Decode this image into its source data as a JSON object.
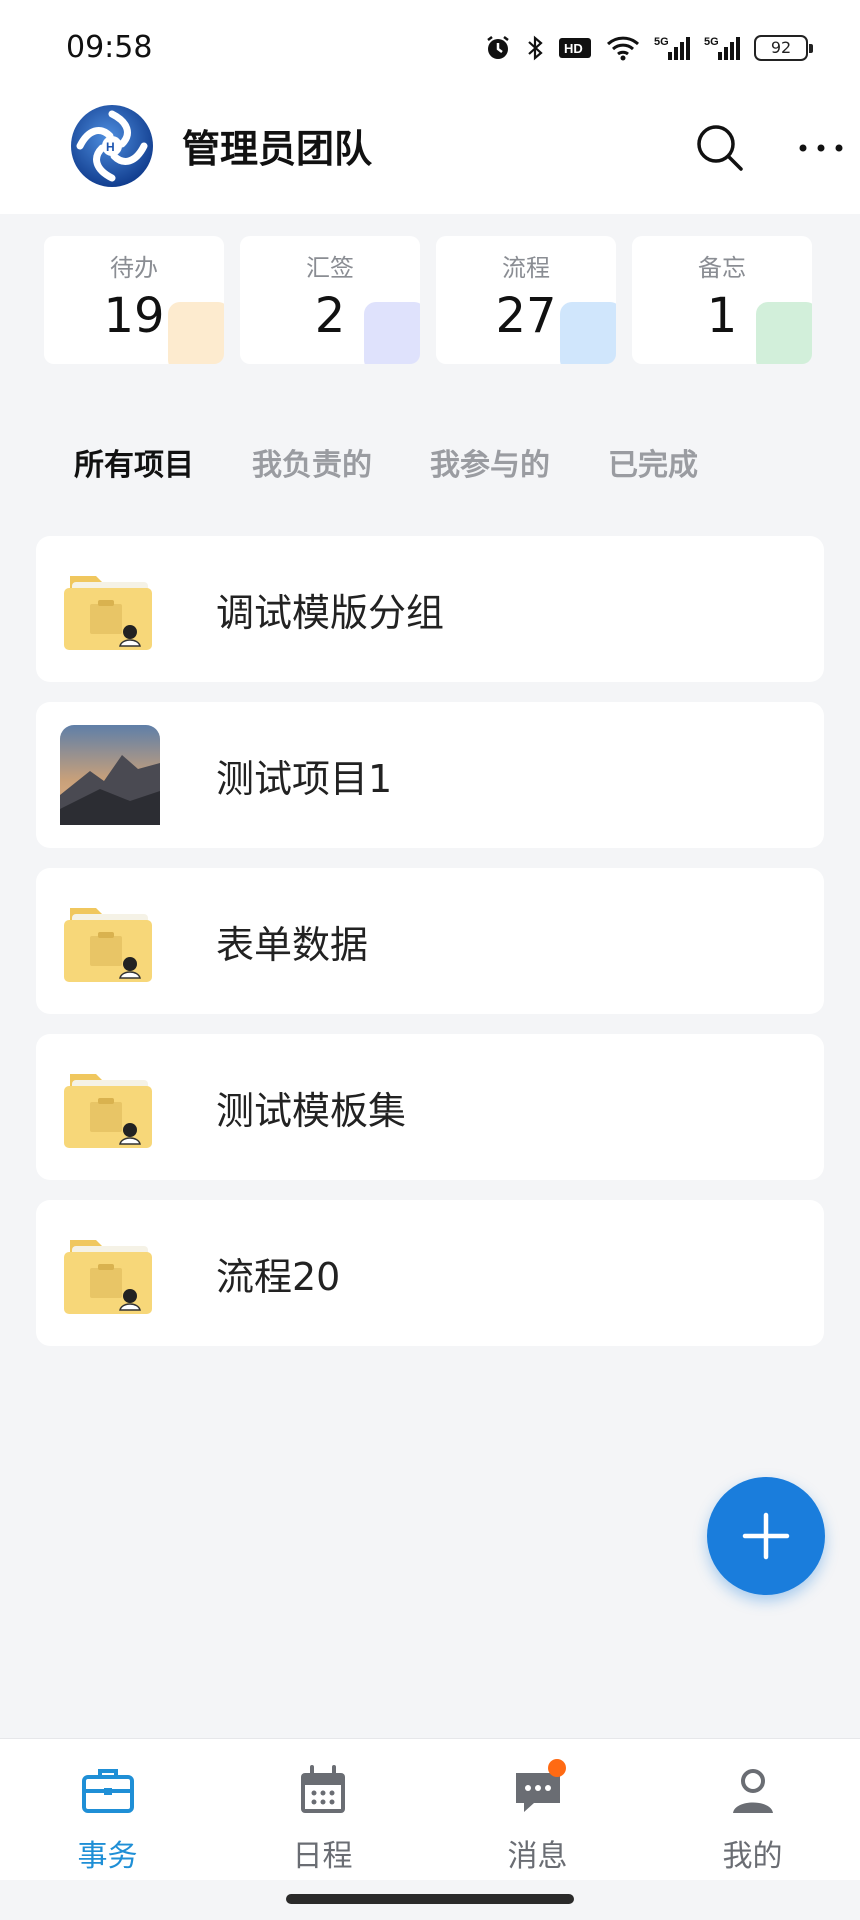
{
  "status_bar": {
    "time": "09:58",
    "battery": "92"
  },
  "header": {
    "title": "管理员团队"
  },
  "stats": [
    {
      "label": "待办",
      "value": "19",
      "accent": "#f5a623"
    },
    {
      "label": "汇签",
      "value": "2",
      "accent": "#6c7cf0"
    },
    {
      "label": "流程",
      "value": "27",
      "accent": "#2a8cf0"
    },
    {
      "label": "备忘",
      "value": "1",
      "accent": "#34b558"
    }
  ],
  "tabs": [
    {
      "label": "所有项目",
      "active": true
    },
    {
      "label": "我负责的",
      "active": false
    },
    {
      "label": "我参与的",
      "active": false
    },
    {
      "label": "已完成",
      "active": false
    }
  ],
  "projects": [
    {
      "label": "调试模版分组",
      "icon": "folder-icon"
    },
    {
      "label": "测试项目1",
      "icon": "photo-thumbnail"
    },
    {
      "label": "表单数据",
      "icon": "folder-icon"
    },
    {
      "label": "测试模板集",
      "icon": "folder-icon"
    },
    {
      "label": "流程20",
      "icon": "folder-icon"
    }
  ],
  "bottom_nav": [
    {
      "label": "事务",
      "icon": "briefcase-icon",
      "active": true
    },
    {
      "label": "日程",
      "icon": "calendar-icon",
      "active": false
    },
    {
      "label": "消息",
      "icon": "chat-icon",
      "active": false,
      "badge": true
    },
    {
      "label": "我的",
      "icon": "user-icon",
      "active": false
    }
  ],
  "colors": {
    "accent": "#1a7ddc",
    "active_nav": "#1f8fd6",
    "badge": "#ff6a13",
    "folder": "#f7d779"
  }
}
